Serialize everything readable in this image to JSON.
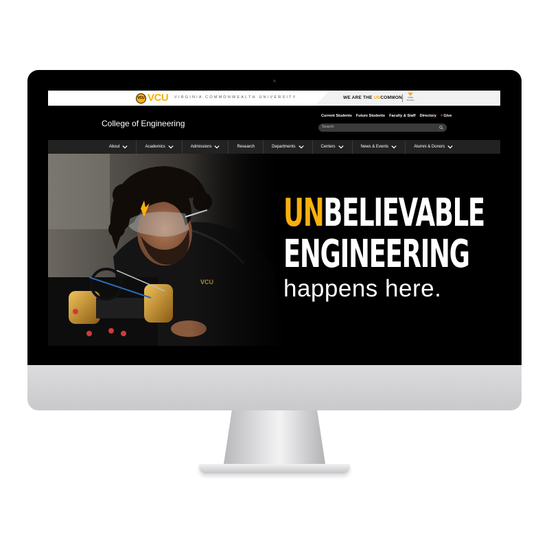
{
  "topbar": {
    "logo_text": "VCU",
    "seal_text": "VCU",
    "university_name": "VIRGINIA COMMONWEALTH UNIVERSITY",
    "slogan_pre": "WE ARE THE ",
    "slogan_highlight": "UN",
    "slogan_post": "COMMON.",
    "give_mini_text": "GIVE TO VCU"
  },
  "header": {
    "site_title": "College of Engineering",
    "util_links": [
      "Current Students",
      "Future Students",
      "Faculty & Staff",
      "Directory"
    ],
    "give_label": "Give",
    "search_placeholder": "Search"
  },
  "nav": {
    "items": [
      "About",
      "Academics",
      "Admissions",
      "Research",
      "Departments",
      "Centers",
      "News & Events",
      "Alumni & Donors"
    ],
    "has_dropdown": [
      true,
      true,
      true,
      false,
      true,
      true,
      true,
      true
    ]
  },
  "hero": {
    "line1_highlight": "UN",
    "line1_rest": "BELIEVABLE",
    "line2": "ENGINEERING",
    "line3": "happens here."
  },
  "colors": {
    "accent": "#f8b00d",
    "background": "#000000",
    "nav_bg": "#222222"
  }
}
